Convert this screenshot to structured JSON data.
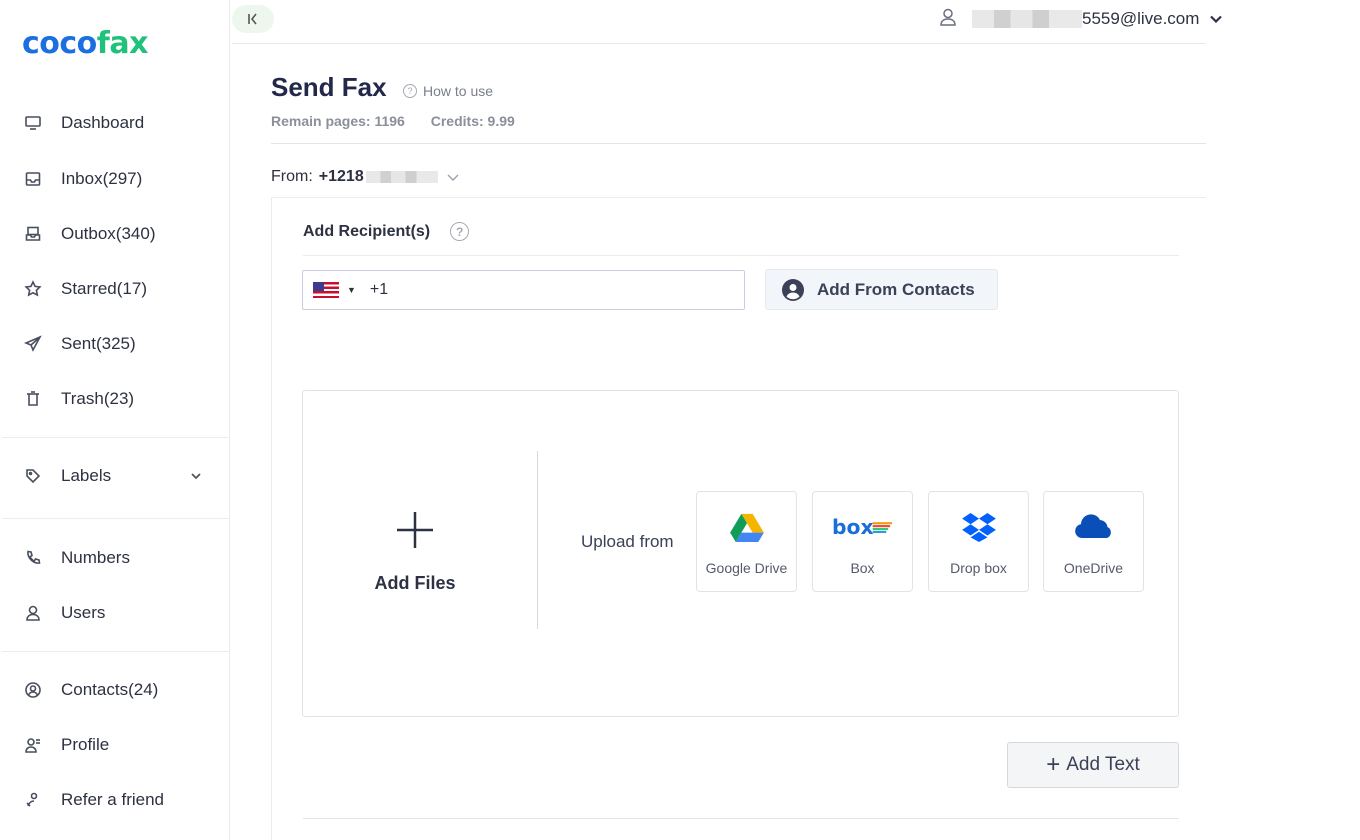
{
  "logo": {
    "part1": "coco",
    "part2": "fax"
  },
  "sidebar": {
    "items": [
      {
        "label": "Dashboard",
        "icon": "monitor-icon"
      },
      {
        "label": "Inbox(297)",
        "icon": "inbox-icon"
      },
      {
        "label": "Outbox(340)",
        "icon": "outbox-icon"
      },
      {
        "label": "Starred(17)",
        "icon": "star-icon"
      },
      {
        "label": "Sent(325)",
        "icon": "paper-plane-icon"
      },
      {
        "label": "Trash(23)",
        "icon": "trash-icon"
      },
      {
        "label": "Labels",
        "icon": "tag-icon"
      },
      {
        "label": "Numbers",
        "icon": "phone-icon"
      },
      {
        "label": "Users",
        "icon": "user-icon"
      },
      {
        "label": "Contacts(24)",
        "icon": "contact-icon"
      },
      {
        "label": "Profile",
        "icon": "profile-icon"
      },
      {
        "label": "Refer a friend",
        "icon": "refer-icon"
      }
    ]
  },
  "topbar": {
    "email_suffix": "5559@live.com"
  },
  "header": {
    "title": "Send Fax",
    "how_to_use": "How to use",
    "remain_pages": "Remain pages: 1196",
    "credits": "Credits: 9.99"
  },
  "from": {
    "label": "From:",
    "number_prefix": "+1218"
  },
  "recipients": {
    "label": "Add Recipient(s)",
    "country_code": "+1",
    "add_from_contacts": "Add From Contacts"
  },
  "upload": {
    "add_files": "Add Files",
    "upload_from": "Upload from",
    "services": [
      {
        "label": "Google Drive",
        "icon": "google-drive-icon"
      },
      {
        "label": "Box",
        "icon": "box-icon"
      },
      {
        "label": "Drop box",
        "icon": "dropbox-icon"
      },
      {
        "label": "OneDrive",
        "icon": "onedrive-icon"
      }
    ]
  },
  "add_text": "Add Text",
  "colors": {
    "brand_blue": "#1b6fe0",
    "brand_green": "#1ec27a",
    "title": "#22284a"
  }
}
